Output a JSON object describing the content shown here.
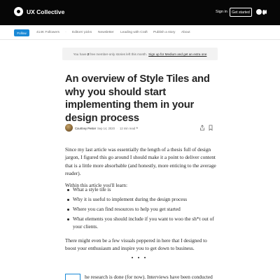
{
  "header": {
    "brand": "UX Collective",
    "sign_in": "Sign in",
    "get_started": "Get started"
  },
  "pubnav": {
    "follow": "Follow",
    "links": [
      "414K Followers",
      "Editors' picks",
      "Newsletter",
      "Leading with Craft",
      "Publish a story",
      "About"
    ]
  },
  "banner": {
    "prefix": "You have",
    "count": "2",
    "suffix": "free member-only stories left this month.",
    "link": "Sign up for Medium and get an extra one"
  },
  "article": {
    "title": "An overview of Style Tiles and why you should start implementing them in your design process",
    "author": "Courtney Pester",
    "date": "Sep 14, 2020",
    "read_time": "12 min read",
    "star": "★",
    "intro": "Since my last article was essentially the length of a thesis full of design jargon, I figured this go around I should make it a point to deliver content that is a little more absorbable (and honestly, more enticing to the average reader).",
    "list_intro": "Within this article you'll learn:",
    "list": [
      "What a style tile is",
      "Why it is useful to implement during the design process",
      "Where you can find resources to help you get started",
      "What elements you should include if you want to woo the sh*t out of your clients."
    ],
    "closing": "There might even be a few visuals peppered in here that I designed to boost your enthusiasm and inspire you to get down to business.",
    "next_para_partial": "he research is done (for now). Interviews have been conducted"
  },
  "icons": {
    "brand": "ux-collective-logo-icon",
    "medium": "medium-logo-icon",
    "share": "share-icon",
    "bookmark": "bookmark-icon"
  },
  "colors": {
    "topbar": "#060606",
    "accent": "#1a89d6",
    "banner_bg": "#f2f2f2"
  }
}
